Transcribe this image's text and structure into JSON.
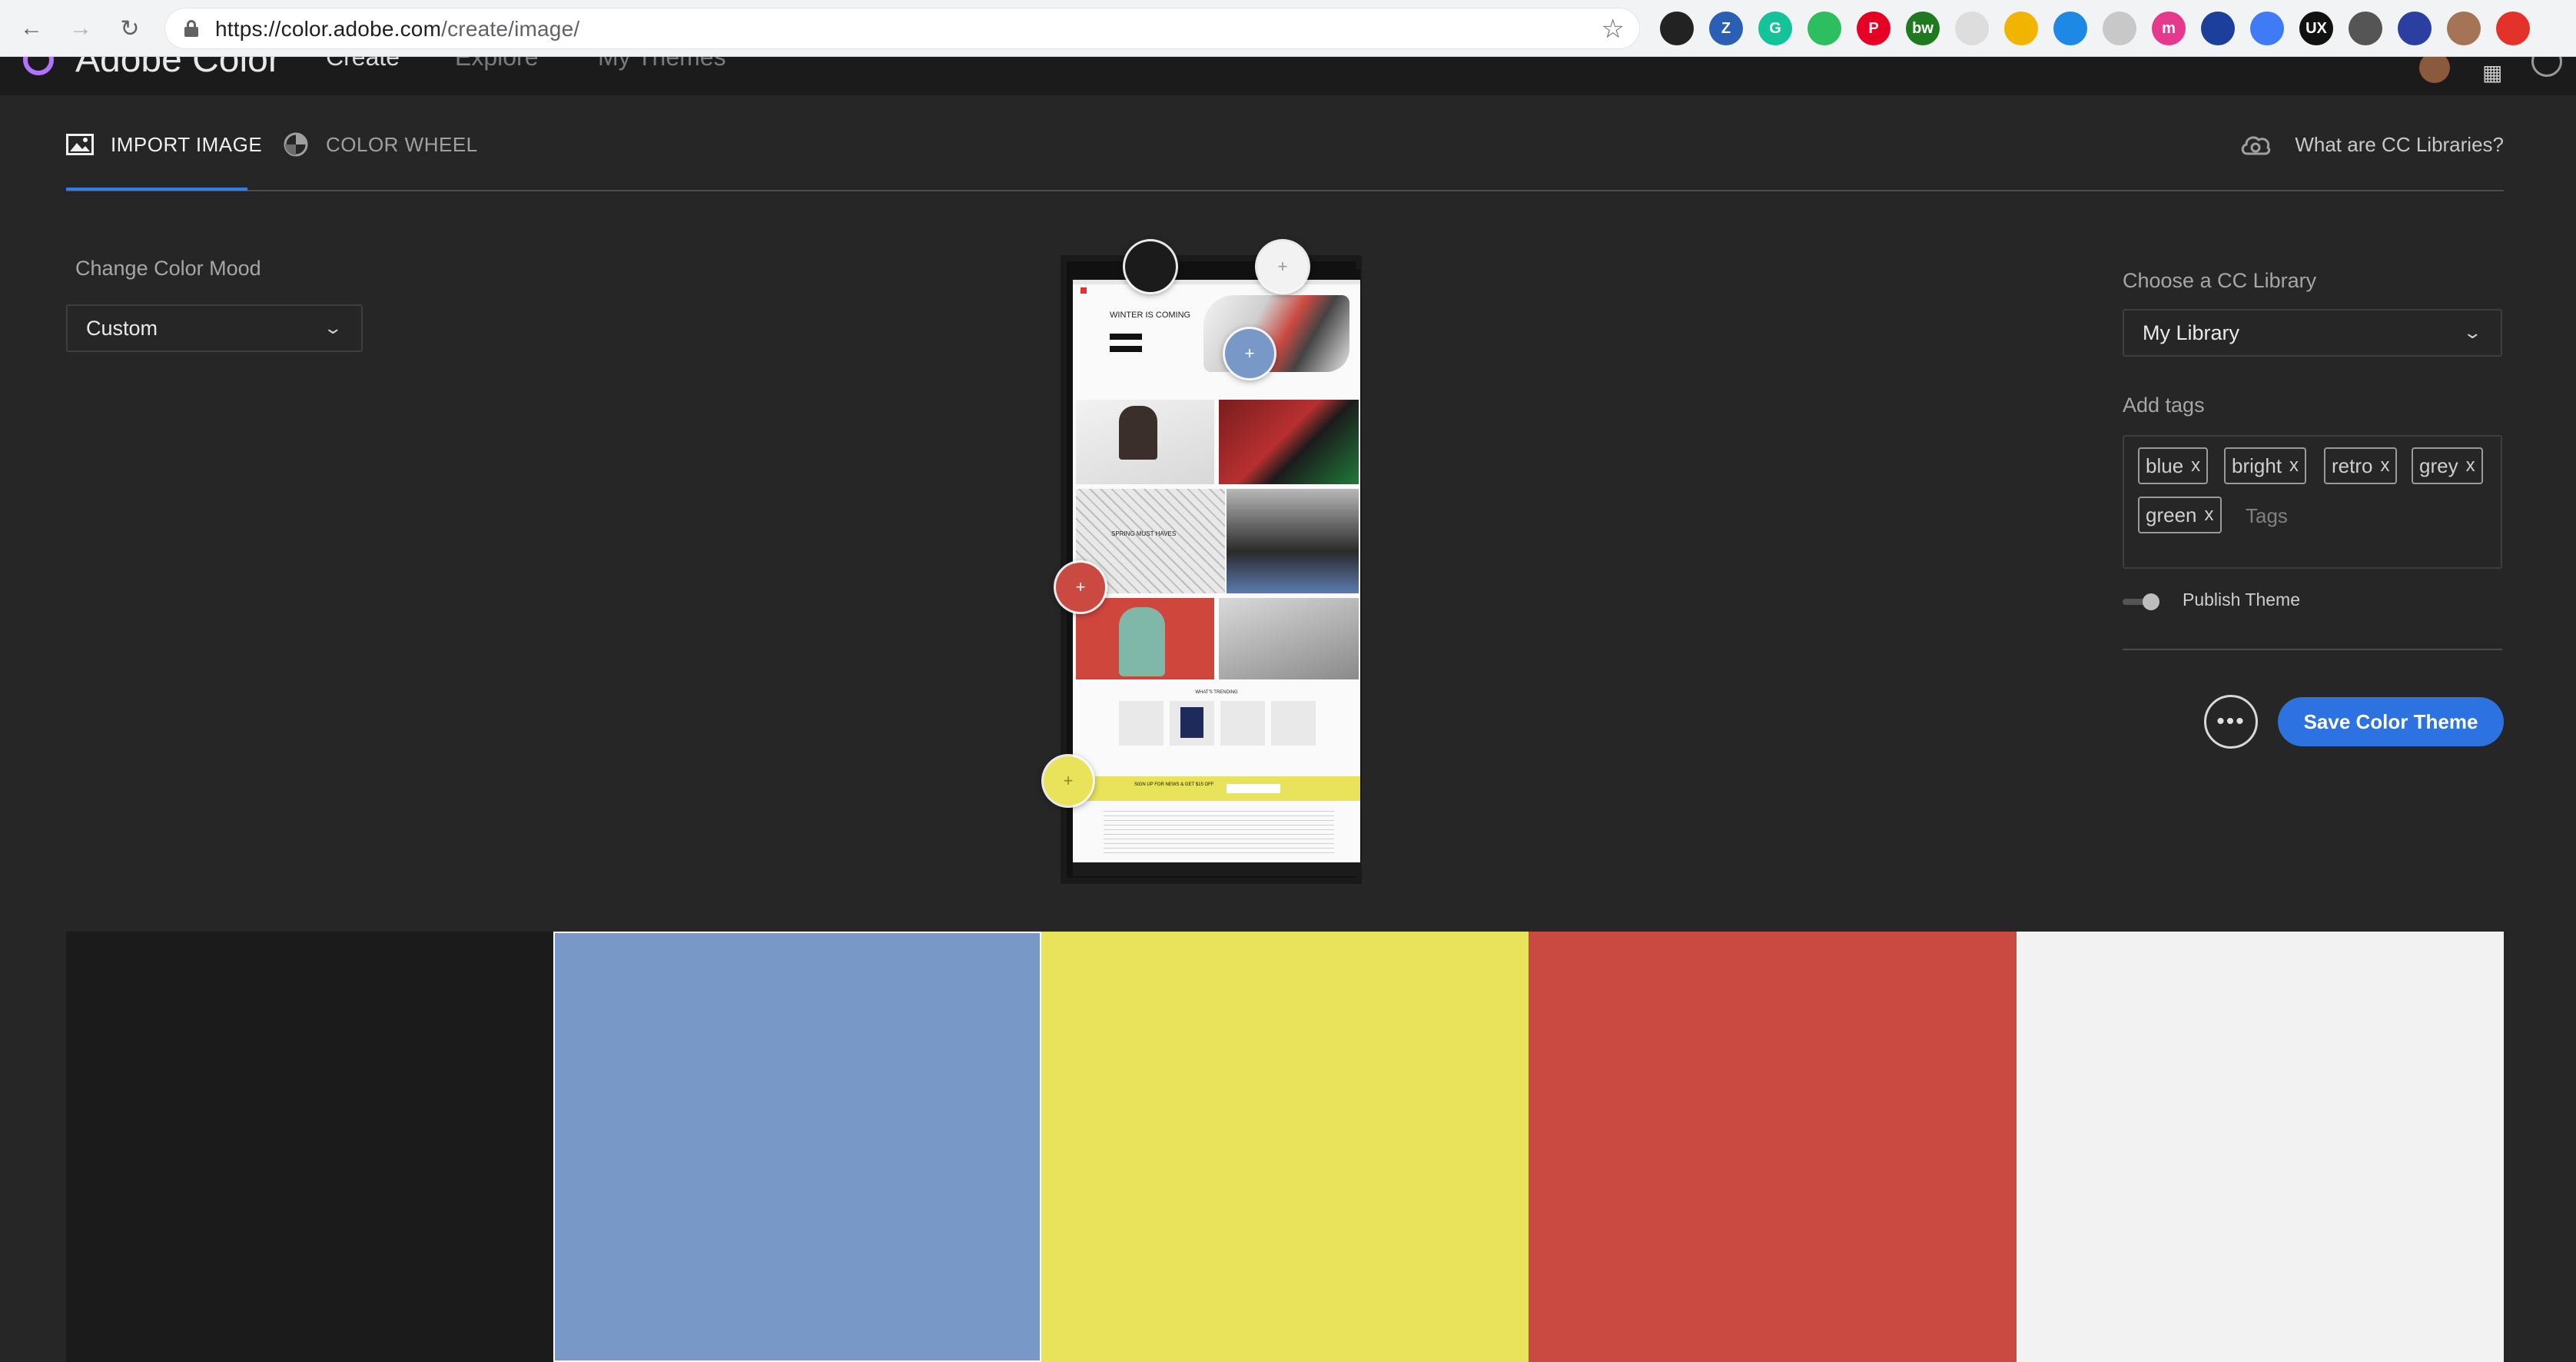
{
  "browser": {
    "url_host": "https://color.adobe.com",
    "url_path": "/create/image/",
    "extensions": [
      {
        "icon": "camera-extension-icon",
        "label": "",
        "color": "#222222"
      },
      {
        "icon": "z-extension-icon",
        "label": "Z",
        "color": "#2b5fb3"
      },
      {
        "icon": "grammarly-icon",
        "label": "G",
        "color": "#15c39a"
      },
      {
        "icon": "evernote-icon",
        "label": "",
        "color": "#2dbe60"
      },
      {
        "icon": "pinterest-icon",
        "label": "P",
        "color": "#e60023"
      },
      {
        "icon": "bw-extension-icon",
        "label": "bw",
        "color": "#1f7a1f"
      },
      {
        "icon": "c-extension-icon",
        "label": "",
        "color": "#dddddd"
      },
      {
        "icon": "pencil-extension-icon",
        "label": "",
        "color": "#f1b400"
      },
      {
        "icon": "circle-extension-icon",
        "label": "",
        "color": "#1e88e5"
      },
      {
        "icon": "grey-extension-icon",
        "label": "",
        "color": "#c8c8c8"
      },
      {
        "icon": "m-extension-icon",
        "label": "m",
        "color": "#e5398d"
      },
      {
        "icon": "bowtie-extension-icon",
        "label": "",
        "color": "#1c3f9b"
      },
      {
        "icon": "arrow-extension-icon",
        "label": "",
        "color": "#3f7bf5"
      },
      {
        "icon": "ux-extension-icon",
        "label": "UX",
        "color": "#111111"
      },
      {
        "icon": "shield-extension-icon",
        "label": "",
        "color": "#555555"
      },
      {
        "icon": "bars-extension-icon",
        "label": "",
        "color": "#2a3fa0"
      },
      {
        "icon": "profile-avatar-icon",
        "label": "",
        "color": "#a57356"
      },
      {
        "icon": "update-extension-icon",
        "label": "",
        "color": "#e3322a"
      }
    ]
  },
  "app": {
    "brand": "Adobe Color",
    "nav": [
      "Create",
      "Explore",
      "My Themes"
    ]
  },
  "tabs": {
    "import_image": "IMPORT IMAGE",
    "color_wheel": "COLOR WHEEL",
    "cc_link": "What are CC Libraries?"
  },
  "left_panel": {
    "mood_label": "Change Color Mood",
    "mood_value": "Custom"
  },
  "right_panel": {
    "library_label": "Choose a CC Library",
    "library_value": "My Library",
    "tags_label": "Add tags",
    "tags": [
      "blue",
      "bright",
      "retro",
      "grey",
      "green"
    ],
    "tag_remove": "x",
    "tags_placeholder": "Tags",
    "publish_label": "Publish Theme",
    "publish_on": true,
    "more_label": "•••",
    "save_label": "Save Color Theme"
  },
  "preview_image": {
    "headline": "WINTER IS COMING",
    "caption": "SPRING MUST HAVES",
    "section_title": "WHAT'S TRENDING",
    "banner_text": "SIGN UP FOR NEWS & GET $15 OFF"
  },
  "palette": {
    "selected_index": 1,
    "colors": [
      "#1b1b1b",
      "#7898c7",
      "#e8e35a",
      "#ca4a42",
      "#f2f2f2"
    ]
  }
}
